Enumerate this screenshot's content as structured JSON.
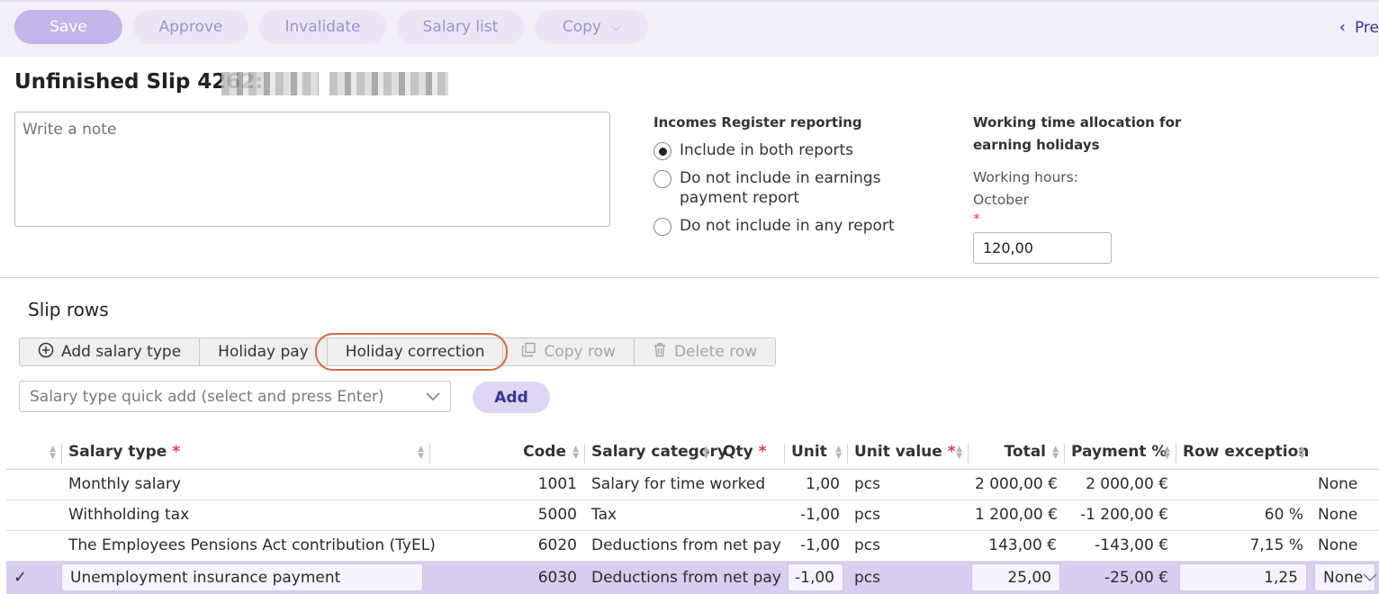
{
  "toolbar": {
    "save": "Save",
    "approve": "Approve",
    "invalidate": "Invalidate",
    "salary_list": "Salary list",
    "copy": "Copy",
    "prev": "Pre"
  },
  "header": {
    "title": "Unfinished Slip 4262:"
  },
  "note": {
    "placeholder": "Write a note"
  },
  "incomes_register": {
    "title": "Incomes Register reporting",
    "options": [
      {
        "label": "Include in both reports",
        "selected": true
      },
      {
        "label": "Do not include in earnings payment report",
        "selected": false
      },
      {
        "label": "Do not include in any report",
        "selected": false
      }
    ]
  },
  "working_time": {
    "title": "Working time allocation for earning holidays",
    "label": "Working hours: October",
    "required_mark": "*",
    "value": "120,00"
  },
  "slip_rows": {
    "title": "Slip rows",
    "buttons": {
      "add_salary_type": "Add salary type",
      "holiday_pay": "Holiday pay",
      "holiday_correction": "Holiday correction",
      "copy_row": "Copy row",
      "delete_row": "Delete row"
    },
    "quick_add_placeholder": "Salary type quick add (select and press Enter)",
    "add": "Add"
  },
  "table": {
    "headers": {
      "salary_type": "Salary type",
      "code": "Code",
      "salary_category": "Salary category",
      "qty": "Qty",
      "unit": "Unit",
      "unit_value": "Unit value",
      "total": "Total",
      "payment_pct": "Payment %",
      "row_exception": "Row exception"
    },
    "required_mark": "*",
    "rows": [
      {
        "salary_type": "Monthly salary",
        "code": "1001",
        "category": "Salary for time worked",
        "qty": "1,00",
        "unit": "pcs",
        "unit_value": "2 000,00 €",
        "total": "2 000,00 €",
        "payment_pct": "",
        "exception": "None"
      },
      {
        "salary_type": "Withholding tax",
        "code": "5000",
        "category": "Tax",
        "qty": "-1,00",
        "unit": "pcs",
        "unit_value": "1 200,00 €",
        "total": "-1 200,00 €",
        "payment_pct": "60 %",
        "exception": "None"
      },
      {
        "salary_type": "The Employees Pensions Act contribution (TyEL)",
        "code": "6020",
        "category": "Deductions from net pay",
        "qty": "-1,00",
        "unit": "pcs",
        "unit_value": "143,00 €",
        "total": "-143,00 €",
        "payment_pct": "7,15 %",
        "exception": "None"
      },
      {
        "salary_type": "Unemployment insurance payment",
        "code": "6030",
        "category": "Deductions from net pay",
        "qty": "-1,00",
        "unit": "pcs",
        "unit_value": "25,00",
        "total": "-25,00 €",
        "payment_pct": "1,25",
        "exception": "None"
      }
    ]
  }
}
